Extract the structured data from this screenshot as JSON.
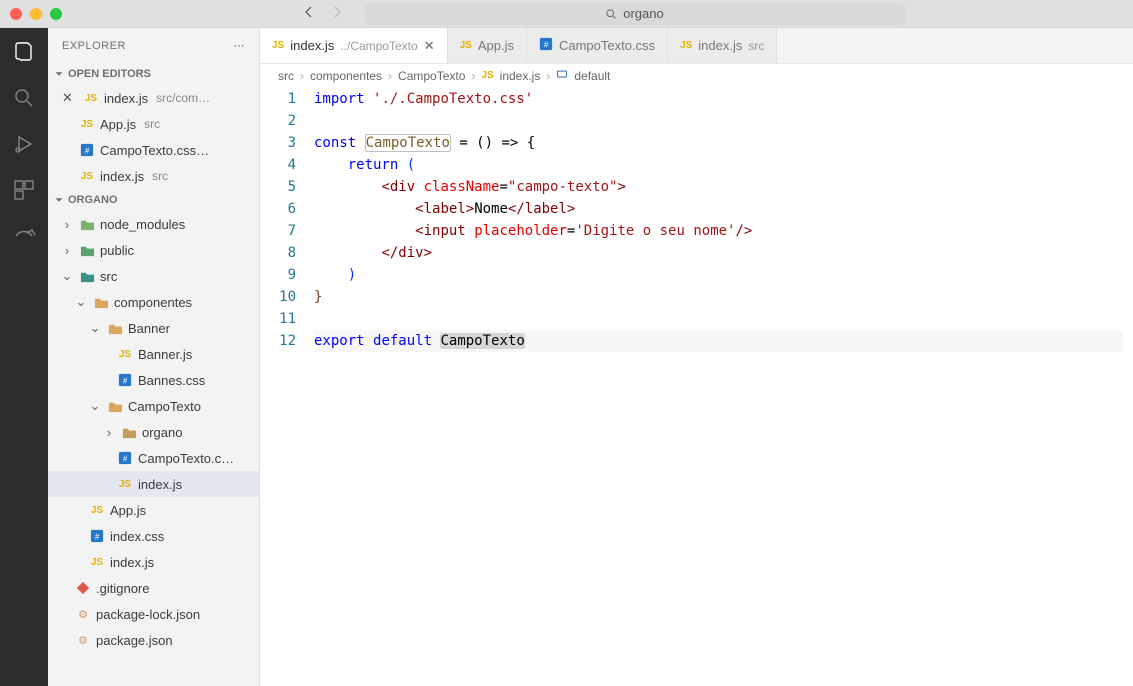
{
  "titlebar": {
    "search": "organo"
  },
  "sidebar": {
    "title": "EXPLORER",
    "openEditors": "OPEN EDITORS",
    "project": "ORGANO",
    "open": [
      {
        "name": "index.js",
        "dim": "src/com…",
        "icon": "js",
        "close": true
      },
      {
        "name": "App.js",
        "dim": "src",
        "icon": "js"
      },
      {
        "name": "CampoTexto.css…",
        "icon": "css"
      },
      {
        "name": "index.js",
        "dim": "src",
        "icon": "js"
      }
    ],
    "tree": {
      "node_modules": "node_modules",
      "public": "public",
      "src": "src",
      "componentes": "componentes",
      "Banner": "Banner",
      "Bannerjs": "Banner.js",
      "Bannescss": "Bannes.css",
      "CampoTexto": "CampoTexto",
      "organo": "organo",
      "CampoTextoc": "CampoTexto.c…",
      "indexjs": "index.js",
      "Appjs": "App.js",
      "indexcss": "index.css",
      "indexjs2": "index.js",
      "gitignore": ".gitignore",
      "pkglock": "package-lock.json",
      "pkg": "package.json"
    }
  },
  "tabs": [
    {
      "icon": "js",
      "label": "index.js",
      "dim": "../CampoTexto",
      "active": true,
      "close": true
    },
    {
      "icon": "js",
      "label": "App.js"
    },
    {
      "icon": "css",
      "label": "CampoTexto.css"
    },
    {
      "icon": "js",
      "label": "index.js",
      "dim": "src"
    }
  ],
  "breadcrumb": {
    "p1": "src",
    "p2": "componentes",
    "p3": "CampoTexto",
    "p4": "index.js",
    "p5": "default"
  },
  "code": {
    "lines": [
      "1",
      "2",
      "3",
      "4",
      "5",
      "6",
      "7",
      "8",
      "9",
      "10",
      "11",
      "12"
    ],
    "import": "import",
    "importPath": "'./.CampoTexto.css'",
    "const": "const",
    "compName": "CampoTexto",
    "arrow": " = () => {",
    "return": "return",
    "divOpen1": "<",
    "divTag": "div",
    "className": "className",
    "classVal": "\"campo-texto\"",
    "labelTag": "label",
    "labelText": "Nome",
    "inputTag": "input",
    "placeholder": "placeholder",
    "placeholderVal": "'Digite o seu nome'",
    "export": "export",
    "default": "default"
  }
}
